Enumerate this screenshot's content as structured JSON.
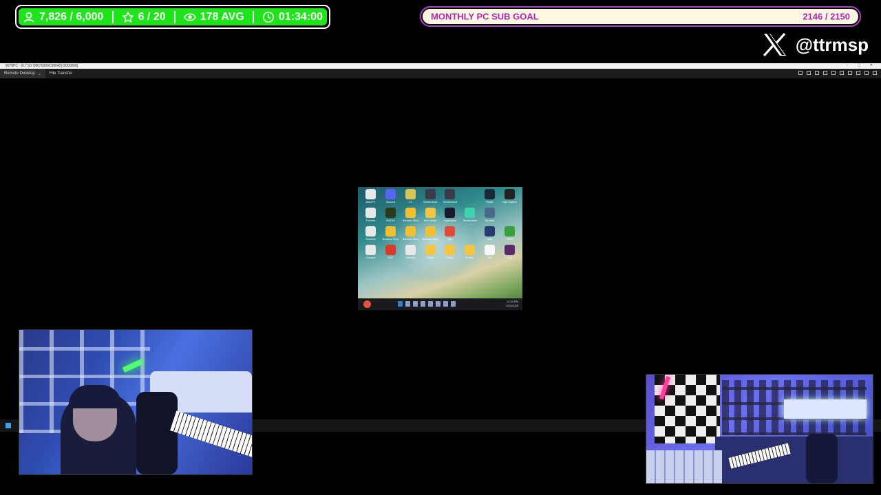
{
  "stats_bar": {
    "items": [
      {
        "icon": "person-icon",
        "value": "7,826 / 6,000"
      },
      {
        "icon": "star-icon",
        "value": "6 / 20"
      },
      {
        "icon": "eye-icon",
        "value": "178 AVG"
      },
      {
        "icon": "clock-icon",
        "value": "01:34:00"
      }
    ],
    "color": "#1ee51a"
  },
  "sub_goal": {
    "title": "MONTHLY PC SUB GOAL",
    "current": 2146,
    "target": 2150,
    "count_text": "2146 / 2150",
    "accent": "#b223b8"
  },
  "social": {
    "icon": "x-logo-icon",
    "handle": "@ttrmsp"
  },
  "remote_desktop": {
    "title": "8078PC - [0.7.50.7]8070000C58040] [0000000]",
    "tabs": [
      "Remote Desktop",
      "File Transfer"
    ],
    "active_tab": "Remote Desktop"
  },
  "remote_screen": {
    "desktop_icons": [
      {
        "label": "AlienFX",
        "color": "#e8e8e8"
      },
      {
        "label": "Discord",
        "color": "#5865f2"
      },
      {
        "label": "T1",
        "color": "#d9c25a"
      },
      {
        "label": "Screenshot",
        "color": "#3a3a48"
      },
      {
        "label": "Screenshot",
        "color": "#3a3a48"
      },
      {
        "label": "",
        "color": "transparent"
      },
      {
        "label": "Steam",
        "color": "#1b2838"
      },
      {
        "label": "Epic Games",
        "color": "#222"
      },
      {
        "label": "Fortnite",
        "color": "#e8e8e8"
      },
      {
        "label": "NVIDIA",
        "color": "#2a3a1a"
      },
      {
        "label": "Banana Shot",
        "color": "#f0c030"
      },
      {
        "label": "New folder",
        "color": "#f4c542"
      },
      {
        "label": "Speedtest",
        "color": "#1a1a2a"
      },
      {
        "label": "Streamlabs",
        "color": "#3fd4b0"
      },
      {
        "label": "Monitor",
        "color": "#4a6a8a"
      },
      {
        "label": "",
        "color": "transparent"
      },
      {
        "label": "Shortcut",
        "color": "#e8e8e8"
      },
      {
        "label": "Banana Shot",
        "color": "#f0c030"
      },
      {
        "label": "Banana Shot",
        "color": "#f0c030"
      },
      {
        "label": "Banana Shot",
        "color": "#f0c030"
      },
      {
        "label": "App",
        "color": "#e24a3a"
      },
      {
        "label": "",
        "color": "transparent"
      },
      {
        "label": "App",
        "color": "#283a70"
      },
      {
        "label": "Xbox",
        "color": "#3aa03a"
      },
      {
        "label": "Chrome",
        "color": "#e8e8e8"
      },
      {
        "label": "PDF",
        "color": "#d83a2a"
      },
      {
        "label": "Chrome",
        "color": "#e8e8e8"
      },
      {
        "label": "Folder",
        "color": "#f4c542"
      },
      {
        "label": "Folder",
        "color": "#f4c542"
      },
      {
        "label": "Folder",
        "color": "#f4c542"
      },
      {
        "label": "File",
        "color": "#f8f8f8"
      },
      {
        "label": "App",
        "color": "#5a2a6a"
      }
    ],
    "clock": {
      "time": "12:34 PM",
      "date": "10/1/2025"
    }
  }
}
